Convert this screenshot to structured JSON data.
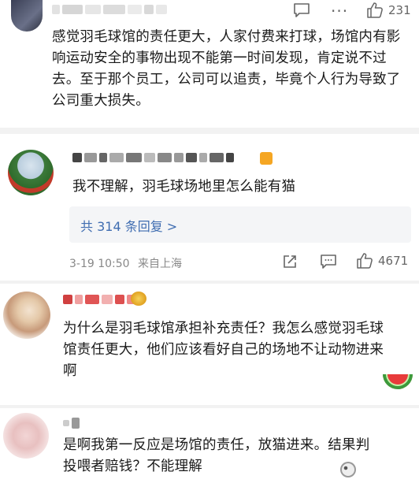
{
  "comment1": {
    "text": "感觉羽毛球馆的责任更大，人家付费来打球，场馆内有影响运动安全的事物出现不能第一时间发现，肯定说不过去。至于那个员工，公司可以追责，毕竟个人行为导致了公司重大损失。",
    "likes": "231"
  },
  "comment2": {
    "text": "我不理解，羽毛球场地里怎么能有猫",
    "reply_link": "共 314 条回复 >",
    "date": "3-19 10:50",
    "location": "来自上海",
    "likes": "4671"
  },
  "comment3": {
    "text": "为什么是羽毛球馆承担补充责任？我怎么感觉羽毛球馆责任更大，他们应该看好自己的场地不让动物进来啊"
  },
  "comment4": {
    "text": "是啊我第一反应是场馆的责任，放猫进来。结果判投喂者赔钱？不能理解"
  },
  "icons": [
    "comment-icon",
    "more-icon",
    "like-icon",
    "share-icon",
    "watermelon-emoji",
    "dizzy-emoji"
  ],
  "colors": {
    "link": "#3f6db1",
    "meta": "#888888",
    "badge": "#f5a623"
  }
}
